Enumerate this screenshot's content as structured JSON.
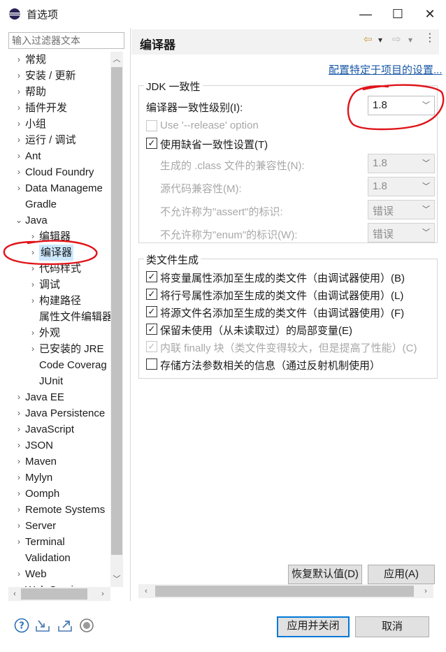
{
  "window": {
    "title": "首选项",
    "controls": {
      "minimize": "—",
      "maximize": "☐",
      "close": "✕"
    }
  },
  "filter": {
    "placeholder": "输入过滤器文本"
  },
  "tree": {
    "items": [
      {
        "label": "常规",
        "twisty": "›"
      },
      {
        "label": "安装 / 更新",
        "twisty": "›"
      },
      {
        "label": "帮助",
        "twisty": "›"
      },
      {
        "label": "插件开发",
        "twisty": "›"
      },
      {
        "label": "小组",
        "twisty": "›"
      },
      {
        "label": "运行 / 调试",
        "twisty": "›"
      },
      {
        "label": "Ant",
        "twisty": "›"
      },
      {
        "label": "Cloud Foundry",
        "twisty": "›"
      },
      {
        "label": "Data Manageme",
        "twisty": "›"
      },
      {
        "label": "Gradle",
        "twisty": ""
      },
      {
        "label": "Java",
        "twisty": "⌄"
      },
      {
        "label": "编辑器",
        "twisty": "›"
      },
      {
        "label": "编译器",
        "twisty": "›",
        "selected": true
      },
      {
        "label": "代码样式",
        "twisty": "›"
      },
      {
        "label": "调试",
        "twisty": "›"
      },
      {
        "label": "构建路径",
        "twisty": "›"
      },
      {
        "label": "属性文件编辑器",
        "twisty": ""
      },
      {
        "label": "外观",
        "twisty": "›"
      },
      {
        "label": "已安装的 JRE",
        "twisty": "›"
      },
      {
        "label": "Code Coverag",
        "twisty": ""
      },
      {
        "label": "JUnit",
        "twisty": ""
      },
      {
        "label": "Java EE",
        "twisty": "›"
      },
      {
        "label": "Java Persistence",
        "twisty": "›"
      },
      {
        "label": "JavaScript",
        "twisty": "›"
      },
      {
        "label": "JSON",
        "twisty": "›"
      },
      {
        "label": "Maven",
        "twisty": "›"
      },
      {
        "label": "Mylyn",
        "twisty": "›"
      },
      {
        "label": "Oomph",
        "twisty": "›"
      },
      {
        "label": "Remote Systems",
        "twisty": "›"
      },
      {
        "label": "Server",
        "twisty": "›"
      },
      {
        "label": "Terminal",
        "twisty": "›"
      },
      {
        "label": "Validation",
        "twisty": ""
      },
      {
        "label": "Web",
        "twisty": "›"
      },
      {
        "label": "Web Services",
        "twisty": "›"
      }
    ]
  },
  "page": {
    "title": "编译器",
    "nav": {
      "back": "⇦",
      "forward": "⇨",
      "dropdown": "▾"
    },
    "config_link": "配置特定于项目的设置..."
  },
  "jdk_group": {
    "title": "JDK 一致性",
    "compliance_label": "编译器一致性级别(I):",
    "compliance_value": "1.8",
    "release_option_label": "Use '--release' option",
    "release_option_checked": false,
    "use_default_label": "使用缺省一致性设置(T)",
    "use_default_checked": true,
    "rows": [
      {
        "label": "生成的 .class 文件的兼容性(N):",
        "value": "1.8"
      },
      {
        "label": "源代码兼容性(M):",
        "value": "1.8"
      },
      {
        "label": "不允许称为\"assert\"的标识:",
        "value": "错误"
      },
      {
        "label": "不允许称为\"enum\"的标识(W):",
        "value": "错误"
      }
    ]
  },
  "classfile_group": {
    "title": "类文件生成",
    "options": [
      {
        "label": "将变量属性添加至生成的类文件（由调试器使用）(B)",
        "checked": true,
        "disabled": false
      },
      {
        "label": "将行号属性添加至生成的类文件（由调试器使用）(L)",
        "checked": true,
        "disabled": false
      },
      {
        "label": "将源文件名添加至生成的类文件（由调试器使用）(F)",
        "checked": true,
        "disabled": false
      },
      {
        "label": "保留未使用（从未读取过）的局部变量(E)",
        "checked": true,
        "disabled": false
      },
      {
        "label": "内联 finally 块（类文件变得较大，但是提高了性能）(C)",
        "checked": true,
        "disabled": true
      },
      {
        "label": "存储方法参数相关的信息（通过反射机制使用）",
        "checked": false,
        "disabled": false
      }
    ]
  },
  "buttons": {
    "restore_defaults": "恢复默认值(D)",
    "apply": "应用(A)",
    "apply_and_close": "应用并关闭",
    "cancel": "取消"
  },
  "footer_icons": [
    "help-icon",
    "import-icon",
    "export-icon",
    "record-icon"
  ],
  "colors": {
    "accent": "#0078d7",
    "annotation": "#e0141b",
    "link": "#1a58a6",
    "selection": "#cce8ff"
  }
}
